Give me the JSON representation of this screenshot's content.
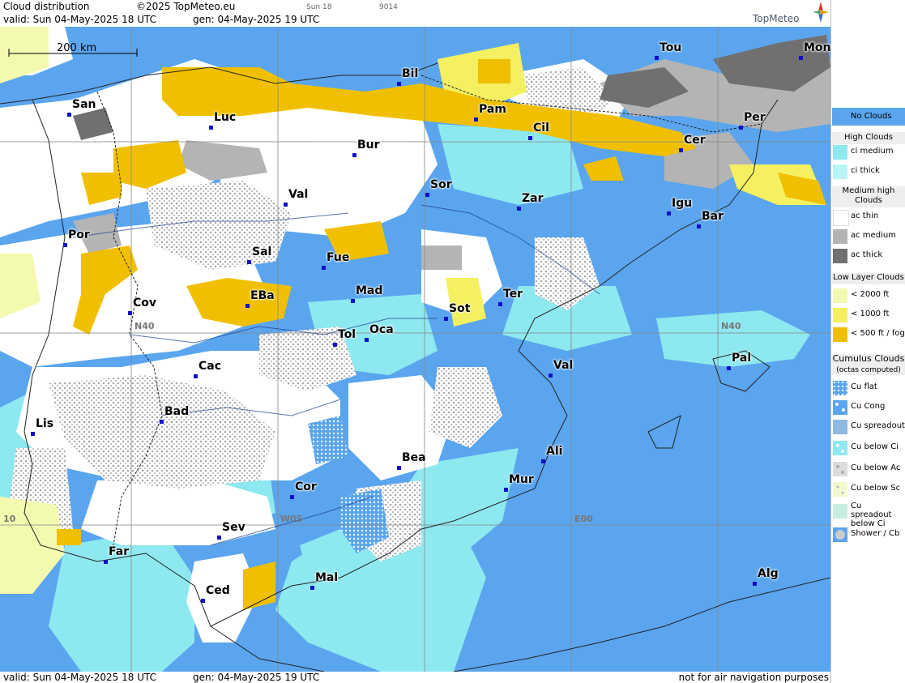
{
  "header": {
    "title": "Cloud distribution",
    "copyright": "©2025 TopMeteo.eu",
    "day_code": "Sun 18",
    "code": "9014",
    "valid": "valid:  Sun  04-May-2025  18 UTC",
    "gen": "gen: 04-May-2025 19 UTC",
    "logo": "TopMeteo"
  },
  "scale": {
    "label": "200 km"
  },
  "grid_labels": {
    "n40_left": "N40",
    "n40_right": "N40",
    "w05": "W05",
    "e00": "E00",
    "w10": "10"
  },
  "cities": [
    {
      "name": "San"
    },
    {
      "name": "Luc"
    },
    {
      "name": "Bil"
    },
    {
      "name": "Pam"
    },
    {
      "name": "Cil"
    },
    {
      "name": "Tou"
    },
    {
      "name": "Mon"
    },
    {
      "name": "Per"
    },
    {
      "name": "Cer"
    },
    {
      "name": "Bur"
    },
    {
      "name": "Val"
    },
    {
      "name": "Sor"
    },
    {
      "name": "Zar"
    },
    {
      "name": "Igu"
    },
    {
      "name": "Bar"
    },
    {
      "name": "Por"
    },
    {
      "name": "Sal"
    },
    {
      "name": "Fue"
    },
    {
      "name": "Mad"
    },
    {
      "name": "Cov"
    },
    {
      "name": "EBa"
    },
    {
      "name": "Sot"
    },
    {
      "name": "Ter"
    },
    {
      "name": "Tol"
    },
    {
      "name": "Oca"
    },
    {
      "name": "Pal"
    },
    {
      "name": "Cac"
    },
    {
      "name": "Val"
    },
    {
      "name": "Bad"
    },
    {
      "name": "Lis"
    },
    {
      "name": "Ali"
    },
    {
      "name": "Bea"
    },
    {
      "name": "Mur"
    },
    {
      "name": "Cor"
    },
    {
      "name": "Sev"
    },
    {
      "name": "Far"
    },
    {
      "name": "Mal"
    },
    {
      "name": "Alg"
    },
    {
      "name": "Ced"
    }
  ],
  "legend": {
    "no_clouds": "No Clouds",
    "high_clouds": "High Clouds",
    "ci_medium": "ci medium",
    "ci_thick": "ci thick",
    "medium_high": "Medium high Clouds",
    "ac_thin": "ac thin",
    "ac_medium": "ac medium",
    "ac_thick": "ac thick",
    "low_layer": "Low Layer Clouds",
    "lt2000": "< 2000 ft",
    "lt1000": "< 1000 ft",
    "lt500": "< 500 ft / fog",
    "cumulus": "Cumulus Clouds",
    "octas": "(octas computed)",
    "cu_flat": "Cu flat",
    "cu_cong": "Cu Cong",
    "cu_spreadout": "Cu spreadout",
    "cu_below_ci": "Cu below Ci",
    "cu_below_ac": "Cu below Ac",
    "cu_below_sc": "Cu below Sc",
    "cu_spreadout_below_ci": "Cu spreadout below Ci",
    "shower": "Shower / Cb"
  },
  "footer": {
    "valid": "valid:  Sun  04-May-2025  18 UTC",
    "gen": "gen: 04-May-2025 19 UTC",
    "note": "not for air navigation purposes"
  },
  "colors": {
    "no_clouds": "#5aa5ee",
    "ci_medium": "#8ee8f0",
    "ci_thick": "#b8f4f8",
    "ac_thin": "#ffffff",
    "ac_medium": "#b4b4b4",
    "ac_thick": "#707070",
    "low_2000": "#f4f9b0",
    "low_1000": "#f4f060",
    "low_500": "#f0c000"
  }
}
